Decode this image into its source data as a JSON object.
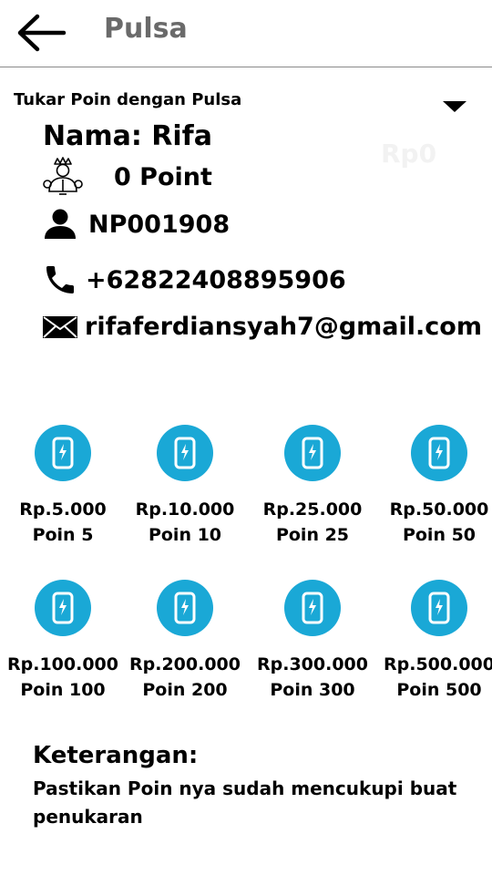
{
  "appbar": {
    "title": "Pulsa",
    "back_icon": "arrow-left-icon"
  },
  "subheader": {
    "label": "Tukar Poin dengan Pulsa",
    "dropdown_icon": "caret-down-icon",
    "ghost_amount": "Rp0"
  },
  "profile": {
    "name_label": "Nama: Rifa",
    "points": "0 Point",
    "member_id": "NP001908",
    "phone": "+62822408895906",
    "email": "rifaferdiansyah7@gmail.com"
  },
  "accent_color": "#1aa8d6",
  "packages": [
    {
      "price": "Rp.5.000",
      "poin": "Poin 5"
    },
    {
      "price": "Rp.10.000",
      "poin": "Poin 10"
    },
    {
      "price": "Rp.25.000",
      "poin": "Poin 25"
    },
    {
      "price": "Rp.50.000",
      "poin": "Poin 50"
    },
    {
      "price": "Rp.100.000",
      "poin": "Poin 100"
    },
    {
      "price": "Rp.200.000",
      "poin": "Poin 200"
    },
    {
      "price": "Rp.300.000",
      "poin": "Poin 300"
    },
    {
      "price": "Rp.500.000",
      "poin": "Poin 500"
    }
  ],
  "note": {
    "heading": "Keterangan:",
    "text": "Pastikan Poin nya sudah mencukupi buat penukaran"
  }
}
